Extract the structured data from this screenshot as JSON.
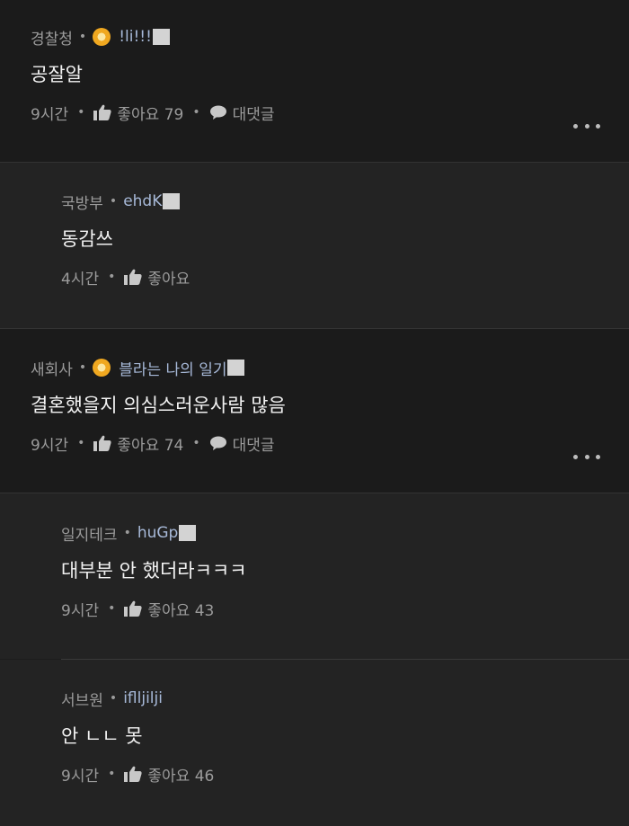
{
  "comments": [
    {
      "company": "경찰청",
      "nick": "!li!!!",
      "has_badge": true,
      "text": "공잘알",
      "time": "9시간",
      "like_label": "좋아요",
      "likes": "79",
      "reply_label": "대댓글"
    },
    {
      "company": "국방부",
      "nick": "ehdK",
      "has_badge": false,
      "text": "동감쓰",
      "time": "4시간",
      "like_label": "좋아요",
      "likes": ""
    },
    {
      "company": "새회사",
      "nick": "블라는 나의 일기",
      "has_badge": true,
      "text": "결혼했을지 의심스러운사람 많음",
      "time": "9시간",
      "like_label": "좋아요",
      "likes": "74",
      "reply_label": "대댓글"
    },
    {
      "company": "일지테크",
      "nick": "huGp",
      "has_badge": false,
      "text": "대부분 안 했더라ㅋㅋㅋ",
      "time": "9시간",
      "like_label": "좋아요",
      "likes": "43"
    },
    {
      "company": "서브원",
      "nick": "iflljilji",
      "has_badge": false,
      "text": "안 ㄴㄴ 못",
      "time": "9시간",
      "like_label": "좋아요",
      "likes": "46"
    }
  ],
  "colors": {
    "background": "#1c1c1c",
    "reply_background": "#232323",
    "nickname": "#a7b9d8",
    "badge": "#f0a820"
  },
  "icons": {
    "badge": "company-verified-badge-icon",
    "like": "thumbs-up-icon",
    "reply": "speech-bubble-icon",
    "more": "more-options-icon"
  }
}
